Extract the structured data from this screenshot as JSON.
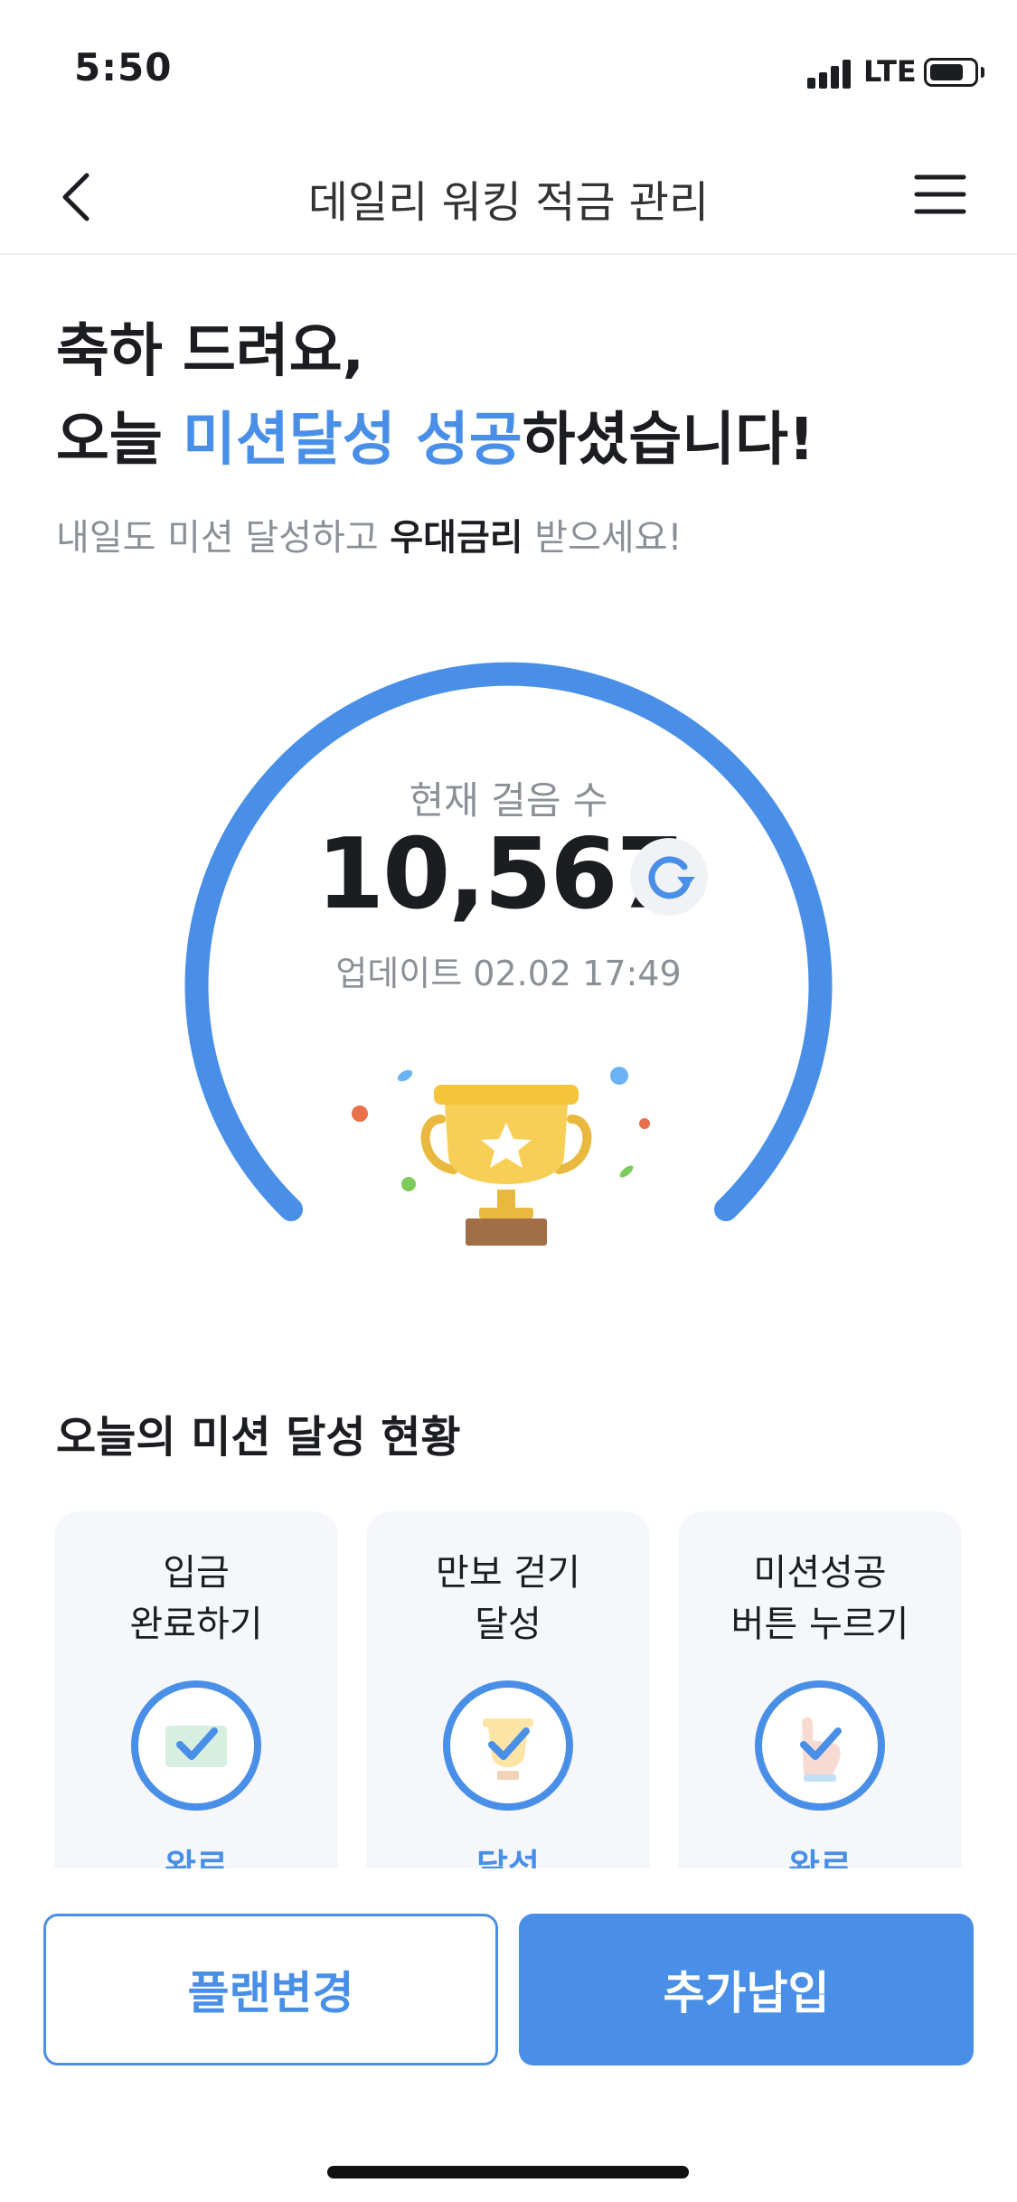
{
  "status_bar": {
    "time": "5:50",
    "network": "LTE"
  },
  "nav": {
    "title": "데일리 워킹 적금 관리",
    "back_icon": "chevron-left-icon",
    "menu_icon": "hamburger-menu-icon"
  },
  "headline": {
    "line1": "축하 드려요,",
    "line2_prefix": "오늘 ",
    "line2_accent": "미션달성 성공",
    "line2_suffix": "하셨습니다!"
  },
  "subline": {
    "prefix": "내일도 미션 달성하고 ",
    "bold": "우대금리",
    "suffix": " 받으세요!"
  },
  "steps": {
    "label": "현재 걸음 수",
    "value": "10,567",
    "update_label": "업데이트",
    "update_time": "02.02 17:49",
    "refresh_icon": "refresh-icon",
    "trophy_icon": "trophy-icon"
  },
  "missions": {
    "title": "오늘의 미션 달성 현황",
    "items": [
      {
        "title": "입금\n완료하기",
        "status": "완료",
        "icon": "check-icon"
      },
      {
        "title": "만보 걷기\n달성",
        "status": "달성",
        "icon": "check-icon"
      },
      {
        "title": "미션성공\n버튼 누르기",
        "status": "완료",
        "icon": "check-icon"
      }
    ]
  },
  "buttons": {
    "change_plan": "플랜변경",
    "add_payment": "추가납입"
  },
  "colors": {
    "accent": "#4a8fe7",
    "text": "#1b1d21",
    "muted": "#8b9096",
    "card_bg": "#f5f7fa",
    "trophy": "#f7cf56",
    "trophy_base": "#a16e47"
  }
}
